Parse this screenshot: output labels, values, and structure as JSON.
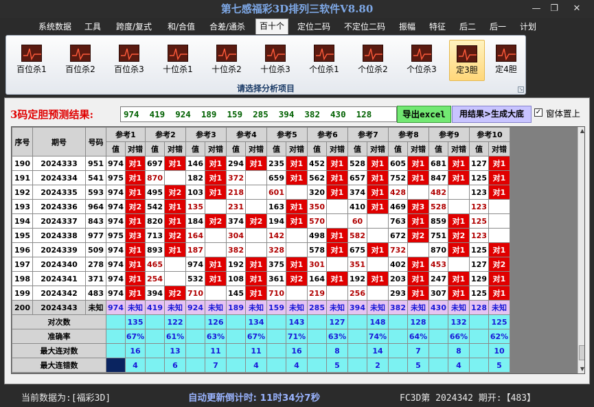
{
  "window": {
    "title": "第七感福彩3D排列三软件V8.80",
    "minimize": "—",
    "restore": "❐",
    "close": "✕"
  },
  "menu": [
    "系统数据",
    "工具",
    "跨度/复式",
    "和/合值",
    "合差/通杀",
    "百十个",
    "定位二码",
    "不定位二码",
    "振幅",
    "特征",
    "后二",
    "后一",
    "计划"
  ],
  "menu_active": 5,
  "ribbon": {
    "buttons": [
      "百位杀1",
      "百位杀2",
      "百位杀3",
      "十位杀1",
      "十位杀2",
      "十位杀3",
      "个位杀1",
      "个位杀2",
      "个位杀3",
      "定3胆",
      "定4胆"
    ],
    "selected": 9,
    "caption": "请选择分析项目"
  },
  "result": {
    "label": "3码定胆预测结果:",
    "value": "974  419  924  189  159  285  394  382  430  128",
    "export_button": "导出excel",
    "generate_button": "用结果>生成大底",
    "ontop_checkbox": "✓",
    "ontop_label": "窗体置上"
  },
  "grid": {
    "headers": {
      "seq": "序号",
      "period": "期号",
      "number": "号码",
      "value": "值",
      "correct": "对错"
    },
    "refs": [
      "参考1",
      "参考2",
      "参考3",
      "参考4",
      "参考5",
      "参考6",
      "参考7",
      "参考8",
      "参考9",
      "参考10"
    ],
    "rows": [
      {
        "seq": "190",
        "period": "2024333",
        "num": "951",
        "cells": [
          [
            "974",
            "对1"
          ],
          [
            "697",
            "对1"
          ],
          [
            "146",
            "对1"
          ],
          [
            "294",
            "对1"
          ],
          [
            "235",
            "对1"
          ],
          [
            "452",
            "对1"
          ],
          [
            "528",
            "对1"
          ],
          [
            "605",
            "对1"
          ],
          [
            "681",
            "对1"
          ],
          [
            "127",
            "对1"
          ]
        ]
      },
      {
        "seq": "191",
        "period": "2024334",
        "num": "541",
        "cells": [
          [
            "975",
            "对1"
          ],
          [
            "870",
            ""
          ],
          [
            "182",
            "对1"
          ],
          [
            "372",
            ""
          ],
          [
            "659",
            "对1"
          ],
          [
            "562",
            "对1"
          ],
          [
            "657",
            "对1"
          ],
          [
            "752",
            "对1"
          ],
          [
            "847",
            "对1"
          ],
          [
            "125",
            "对1"
          ]
        ]
      },
      {
        "seq": "192",
        "period": "2024335",
        "num": "593",
        "cells": [
          [
            "974",
            "对1"
          ],
          [
            "495",
            "对2"
          ],
          [
            "103",
            "对1"
          ],
          [
            "218",
            ""
          ],
          [
            "601",
            ""
          ],
          [
            "320",
            "对1"
          ],
          [
            "374",
            "对1"
          ],
          [
            "428",
            ""
          ],
          [
            "482",
            ""
          ],
          [
            "123",
            "对1"
          ]
        ]
      },
      {
        "seq": "193",
        "period": "2024336",
        "num": "964",
        "cells": [
          [
            "974",
            "对2"
          ],
          [
            "542",
            "对1"
          ],
          [
            "135",
            ""
          ],
          [
            "231",
            ""
          ],
          [
            "163",
            "对1"
          ],
          [
            "350",
            ""
          ],
          [
            "410",
            "对1"
          ],
          [
            "469",
            "对3"
          ],
          [
            "528",
            ""
          ],
          [
            "123",
            ""
          ]
        ]
      },
      {
        "seq": "194",
        "period": "2024337",
        "num": "843",
        "cells": [
          [
            "974",
            "对1"
          ],
          [
            "820",
            "对1"
          ],
          [
            "184",
            "对2"
          ],
          [
            "374",
            "对2"
          ],
          [
            "194",
            "对1"
          ],
          [
            "570",
            ""
          ],
          [
            "60",
            ""
          ],
          [
            "763",
            "对1"
          ],
          [
            "859",
            "对1"
          ],
          [
            "125",
            ""
          ]
        ]
      },
      {
        "seq": "195",
        "period": "2024338",
        "num": "977",
        "cells": [
          [
            "975",
            "对3"
          ],
          [
            "713",
            "对2"
          ],
          [
            "164",
            ""
          ],
          [
            "304",
            ""
          ],
          [
            "142",
            ""
          ],
          [
            "498",
            "对1"
          ],
          [
            "582",
            ""
          ],
          [
            "672",
            "对2"
          ],
          [
            "751",
            "对2"
          ],
          [
            "123",
            ""
          ]
        ]
      },
      {
        "seq": "196",
        "period": "2024339",
        "num": "509",
        "cells": [
          [
            "974",
            "对1"
          ],
          [
            "893",
            "对1"
          ],
          [
            "187",
            ""
          ],
          [
            "382",
            ""
          ],
          [
            "328",
            ""
          ],
          [
            "578",
            "对1"
          ],
          [
            "675",
            "对1"
          ],
          [
            "732",
            ""
          ],
          [
            "870",
            "对1"
          ],
          [
            "125",
            "对1"
          ]
        ]
      },
      {
        "seq": "197",
        "period": "2024340",
        "num": "278",
        "cells": [
          [
            "974",
            "对1"
          ],
          [
            "465",
            ""
          ],
          [
            "974",
            "对1"
          ],
          [
            "192",
            "对1"
          ],
          [
            "375",
            "对1"
          ],
          [
            "301",
            ""
          ],
          [
            "351",
            ""
          ],
          [
            "402",
            "对1"
          ],
          [
            "453",
            ""
          ],
          [
            "127",
            "对2"
          ]
        ]
      },
      {
        "seq": "198",
        "period": "2024341",
        "num": "371",
        "cells": [
          [
            "974",
            "对1"
          ],
          [
            "254",
            ""
          ],
          [
            "532",
            "对1"
          ],
          [
            "108",
            "对1"
          ],
          [
            "361",
            "对2"
          ],
          [
            "164",
            "对1"
          ],
          [
            "192",
            "对1"
          ],
          [
            "203",
            "对1"
          ],
          [
            "247",
            "对1"
          ],
          [
            "129",
            "对1"
          ]
        ]
      },
      {
        "seq": "199",
        "period": "2024342",
        "num": "483",
        "cells": [
          [
            "974",
            "对1"
          ],
          [
            "394",
            "对2"
          ],
          [
            "710",
            ""
          ],
          [
            "145",
            "对1"
          ],
          [
            "710",
            ""
          ],
          [
            "219",
            ""
          ],
          [
            "256",
            ""
          ],
          [
            "293",
            "对1"
          ],
          [
            "307",
            "对1"
          ],
          [
            "125",
            "对1"
          ]
        ]
      }
    ],
    "unknown_row": {
      "seq": "200",
      "period": "2024343",
      "num": "未知",
      "values": [
        "974",
        "419",
        "924",
        "189",
        "159",
        "285",
        "394",
        "382",
        "430",
        "128"
      ],
      "label": "未知"
    },
    "stats": [
      {
        "label": "对次数",
        "values": [
          "135",
          "122",
          "126",
          "134",
          "143",
          "127",
          "148",
          "128",
          "132",
          "125"
        ]
      },
      {
        "label": "准确率",
        "values": [
          "67%",
          "61%",
          "63%",
          "67%",
          "71%",
          "63%",
          "74%",
          "64%",
          "66%",
          "62%"
        ]
      },
      {
        "label": "最大连对数",
        "values": [
          "16",
          "13",
          "11",
          "11",
          "16",
          "8",
          "14",
          "7",
          "8",
          "10"
        ]
      },
      {
        "label": "最大连错数",
        "values": [
          "4",
          "6",
          "7",
          "4",
          "4",
          "5",
          "2",
          "5",
          "4",
          "5"
        ]
      }
    ]
  },
  "status": {
    "current_data": "当前数据为:[福彩3D]",
    "countdown": "自动更新倒计时:  11时34分7秒",
    "issue": "FC3D第 2024342 期开:【483】"
  },
  "colors": {
    "hit": "#e00000",
    "unknown_row": "#e6c4f2",
    "stats_row": "#7cf2f2",
    "title": "#7ea8e6"
  }
}
